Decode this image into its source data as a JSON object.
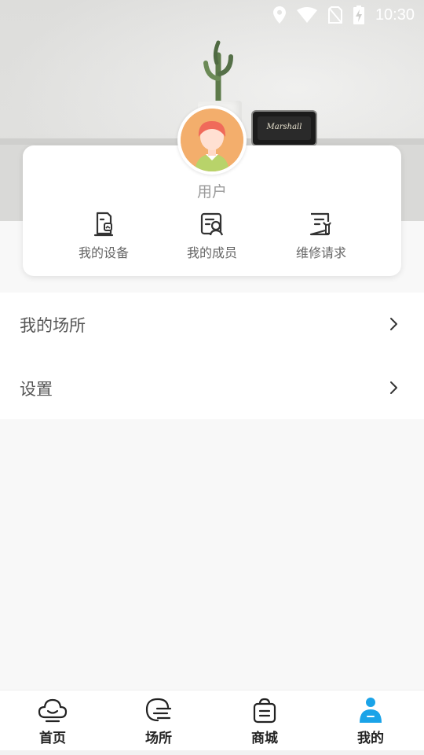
{
  "status_bar": {
    "time": "10:30",
    "icons": [
      "location-icon",
      "wifi-icon",
      "no-sim-icon",
      "battery-charging-icon"
    ]
  },
  "header": {
    "speaker_brand": "Marshall"
  },
  "profile": {
    "username": "用户",
    "avatar_icon": "avatar-girl-icon",
    "shortcuts": [
      {
        "label": "我的设备",
        "icon": "device-icon"
      },
      {
        "label": "我的成员",
        "icon": "members-icon"
      },
      {
        "label": "维修请求",
        "icon": "repair-icon"
      }
    ]
  },
  "menu": {
    "items": [
      {
        "label": "我的场所",
        "icon": "chevron-right-icon"
      },
      {
        "label": "设置",
        "icon": "chevron-right-icon"
      }
    ]
  },
  "bottom_nav": {
    "active_index": 3,
    "active_color": "#1aa3e8",
    "items": [
      {
        "label": "首页",
        "icon": "cloud-home-icon"
      },
      {
        "label": "场所",
        "icon": "place-icon"
      },
      {
        "label": "商城",
        "icon": "shopping-bag-icon"
      },
      {
        "label": "我的",
        "icon": "person-icon"
      }
    ]
  }
}
